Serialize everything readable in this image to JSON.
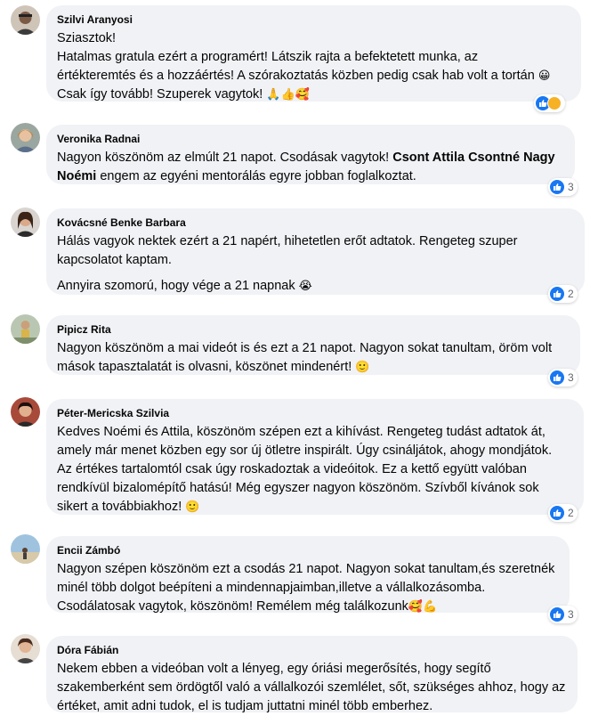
{
  "colors": {
    "bubble": "#f0f2f5",
    "like": "#1877f2",
    "text": "#050505",
    "meta": "#65676b"
  },
  "comments": [
    {
      "author": "Szilvi Aranyosi",
      "lines": [
        "Sziasztok!",
        "Hatalmas gratula ezért a programért! Látszik rajta a befektetett munka, az",
        "értékteremtés és a hozzáértés! A szórakoztatás közben pedig csak hab volt a tortán",
        "Csak így tovább! Szuperek vagytok!"
      ],
      "line3_emoji": "😀",
      "line4_emoji": "🙏👍🥰",
      "reactions": [
        "like-icon",
        "care-icon"
      ],
      "reaction_count": ""
    },
    {
      "author": "Veronika Radnai",
      "line1": "Nagyon köszönöm az elmúlt 21 napot. Csodásak vagytok!",
      "tag1": "Csont Attila Csontné Nagy",
      "tag2": "Noémi",
      "line2_rest": " engem az egyéni mentorálás egyre jobban foglalkoztat.",
      "reaction_count": "3"
    },
    {
      "author": "Kovácsné Benke Barbara",
      "lines": [
        "Hálás vagyok nektek ezért a 21 napért, hihetetlen erőt adtatok. Rengeteg szuper",
        "kapcsolatot kaptam."
      ],
      "para2": "Annyira szomorú, hogy vége a 21 napnak",
      "para2_emoji": "😭",
      "reaction_count": "2"
    },
    {
      "author": "Pipicz Rita",
      "lines": [
        "Nagyon köszönöm a mai videót is és ezt a 21 napot. Nagyon sokat tanultam, öröm volt",
        "mások tapasztalatát is olvasni, köszönet mindenért!"
      ],
      "line2_emoji": "🙂",
      "reaction_count": "3"
    },
    {
      "author": "Péter-Mericska Szilvia",
      "lines": [
        "Kedves Noémi és Attila, köszönöm szépen ezt a kihívást. Rengeteg tudást adtatok át,",
        "amely már menet közben egy sor új ötletre inspirált. Úgy csináljátok, ahogy mondjátok.",
        "Az értékes tartalomtól csak úgy roskadoztak a videóitok. Ez a kettő együtt valóban",
        "rendkívül bizalomépítő hatású! Még egyszer nagyon köszönöm. Szívből kívánok sok",
        "sikert a továbbiakhoz!"
      ],
      "line5_emoji": "🙂",
      "reaction_count": "2"
    },
    {
      "author": "Encii Zámbó",
      "lines": [
        "Nagyon szépen köszönöm ezt a csodás 21 napot. Nagyon sokat tanultam,és szeretnék",
        "minél több dolgot beépíteni a mindennapjaimban,illetve a vállalkozásomba.",
        "Csodálatosak vagytok, köszönöm! Remélem még találkozunk"
      ],
      "line3_emoji": "🥰💪",
      "reaction_count": "3"
    },
    {
      "author": "Dóra Fábián",
      "lines": [
        "Nekem ebben a videóban volt a lényeg, egy óriási megerősítés, hogy segítő",
        "szakemberként sem ördögtől való a vállalkozói szemlélet, sőt, szükséges ahhoz, hogy az",
        "értéket, amit adni tudok, el is tudjam juttatni minél több emberhez."
      ]
    }
  ]
}
